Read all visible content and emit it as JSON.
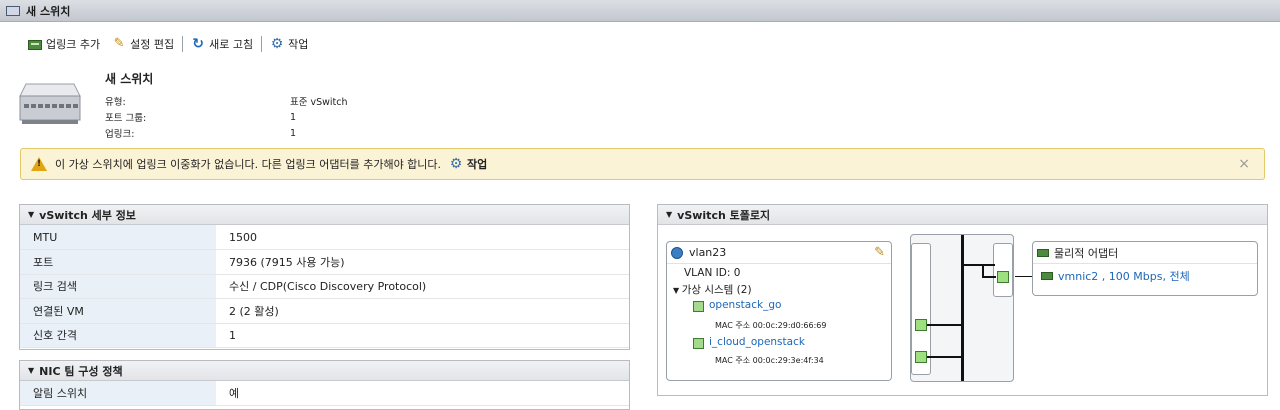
{
  "window": {
    "title": "새 스위치"
  },
  "toolbar": {
    "add_uplink": "업링크 추가",
    "edit_settings": "설정 편집",
    "refresh": "새로 고침",
    "actions": "작업"
  },
  "summary": {
    "name": "새 스위치",
    "type_label": "유형:",
    "type_value": "표준 vSwitch",
    "portgroups_label": "포트 그룹:",
    "portgroups_value": "1",
    "uplinks_label": "업링크:",
    "uplinks_value": "1"
  },
  "warning": {
    "message": "이 가상 스위치에 업링크 이중화가 없습니다. 다른 업링크 어댑터를 추가해야 합니다.",
    "action": "작업",
    "close": "×"
  },
  "details_panel": {
    "title": "vSwitch 세부 정보",
    "rows": [
      {
        "label": "MTU",
        "value": "1500"
      },
      {
        "label": "포트",
        "value": "7936 (7915 사용 가능)"
      },
      {
        "label": "링크 검색",
        "value": "수신 / CDP(Cisco Discovery Protocol)"
      },
      {
        "label": "연결된 VM",
        "value": "2 (2 활성)"
      },
      {
        "label": "신호 간격",
        "value": "1"
      }
    ]
  },
  "nic_panel": {
    "title": "NIC 팀 구성 정책",
    "rows": [
      {
        "label": "알림 스위치",
        "value": "예"
      }
    ]
  },
  "topology": {
    "title": "vSwitch 토폴로지",
    "portgroup": {
      "name": "vlan23",
      "vlan": "VLAN ID: 0",
      "vm_group": "가상 시스템 (2)",
      "vms": [
        {
          "name": "openstack_go",
          "mac": "MAC 주소 00:0c:29:d0:66:69"
        },
        {
          "name": "i_cloud_openstack",
          "mac": "MAC 주소 00:0c:29:3e:4f:34"
        }
      ]
    },
    "physical": {
      "title": "물리적 어댑터",
      "nic": "vmnic2 , 100 Mbps, 전체"
    }
  }
}
